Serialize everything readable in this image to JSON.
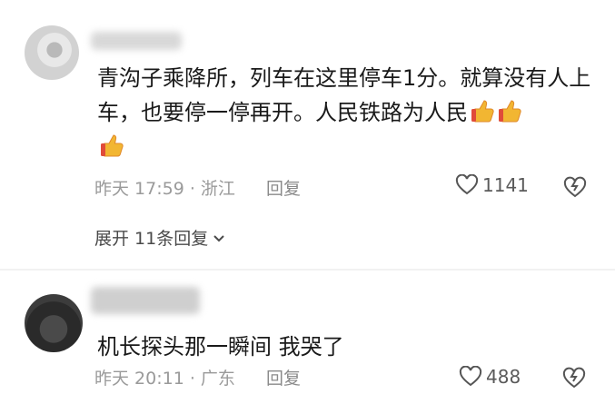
{
  "comments": [
    {
      "text": "青沟子乘降所，列车在这里停车1分。就算没有人上车，也要停一停再开。人民铁路为人民",
      "emoji_count": 3,
      "emoji_icon": "thumbs-up-icon",
      "time": "昨天 17:59 · 浙江",
      "reply_label": "回复",
      "likes": "1141",
      "expand_label": "展开 11条回复"
    },
    {
      "text": "机长探头那一瞬间 我哭了",
      "time": "昨天 20:11 · 广东",
      "reply_label": "回复",
      "likes": "488"
    }
  ],
  "colors": {
    "meta": "#9a9a9a",
    "text": "#1a1a1a",
    "emoji": "#f2b632"
  }
}
